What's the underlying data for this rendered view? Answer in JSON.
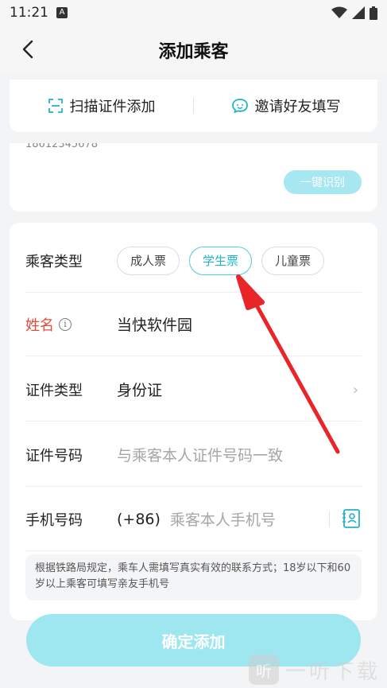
{
  "status": {
    "time": "11:21",
    "indicator": "A"
  },
  "header": {
    "title": "添加乘客",
    "back_icon": "chevron-left-icon"
  },
  "actions": {
    "scan_label": "扫描证件添加",
    "invite_label": "邀请好友填写"
  },
  "recognize": {
    "peek_text": "18612345678",
    "button_label": "一键识别"
  },
  "form": {
    "passenger_type": {
      "label": "乘客类型",
      "options": [
        "成人票",
        "学生票",
        "儿童票"
      ],
      "selected": "学生票"
    },
    "name": {
      "label": "姓名",
      "value": "当快软件园"
    },
    "id_type": {
      "label": "证件类型",
      "value": "身份证"
    },
    "id_number": {
      "label": "证件号码",
      "placeholder": "与乘客本人证件号码一致"
    },
    "phone": {
      "label": "手机号码",
      "prefix": "(+86)",
      "placeholder": "乘客本人手机号"
    },
    "notice": "根据铁路局规定，乘车人需填写真实有效的联系方式；18岁以下和60岁以上乘客可填写亲友手机号"
  },
  "submit_label": "确定添加",
  "watermark": {
    "logo_text": "听",
    "text": "一听下载"
  },
  "colors": {
    "accent": "#21b4c7",
    "accent_light": "#9ee6f0",
    "required_label": "#e34b3a",
    "arrow": "#e8262a"
  }
}
